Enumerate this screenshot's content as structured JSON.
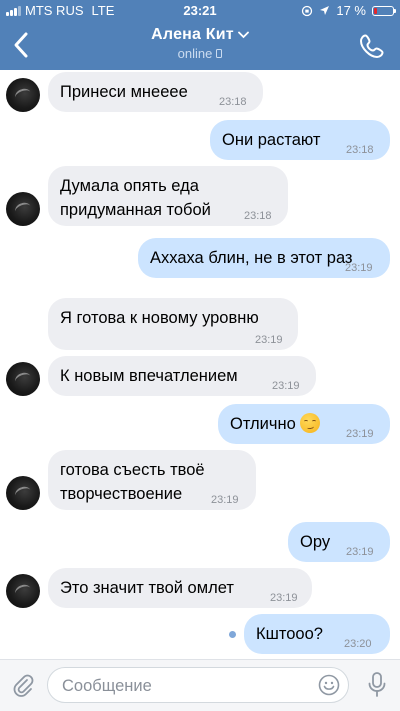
{
  "status_bar": {
    "carrier": "MTS RUS",
    "network": "LTE",
    "time": "23:21",
    "battery_percent": "17 %",
    "battery_level": 0.17,
    "battery_color": "#e0282e"
  },
  "header": {
    "contact_name": "Алена Кит",
    "status": "online",
    "back_icon": "chevron-left-icon",
    "call_icon": "phone-icon",
    "accent_color": "#5181b8"
  },
  "messages": [
    {
      "dir": "in",
      "text": "Принеси мнеееe",
      "time": "23:18",
      "avatar": true
    },
    {
      "dir": "out",
      "text": "Они растают",
      "time": "23:18"
    },
    {
      "dir": "in",
      "text": "Думала опять еда\nпридуманная тобой",
      "time": "23:18",
      "avatar": true
    },
    {
      "dir": "out",
      "text": "Аххаха блин, не в этот раз",
      "time": "23:19"
    },
    {
      "dir": "in",
      "text": "Я готова к новому уровню",
      "time": "23:19"
    },
    {
      "dir": "in",
      "text": "К новым впечатлением",
      "time": "23:19",
      "avatar": true
    },
    {
      "dir": "out",
      "text": "Отлично",
      "time": "23:19",
      "emoji": "smirk-emoji"
    },
    {
      "dir": "in",
      "text": "готова съесть твоё\nтворчествоение",
      "time": "23:19",
      "avatar": true
    },
    {
      "dir": "out",
      "text": "Ору",
      "time": "23:19"
    },
    {
      "dir": "in",
      "text": "Это значит твой омлет",
      "time": "23:19",
      "avatar": true
    },
    {
      "dir": "out",
      "text": "Кштооо?",
      "time": "23:20",
      "unread": true
    }
  ],
  "composer": {
    "placeholder": "Сообщение",
    "attach_icon": "paperclip-icon",
    "emoji_icon": "smiley-icon",
    "mic_icon": "microphone-icon"
  }
}
